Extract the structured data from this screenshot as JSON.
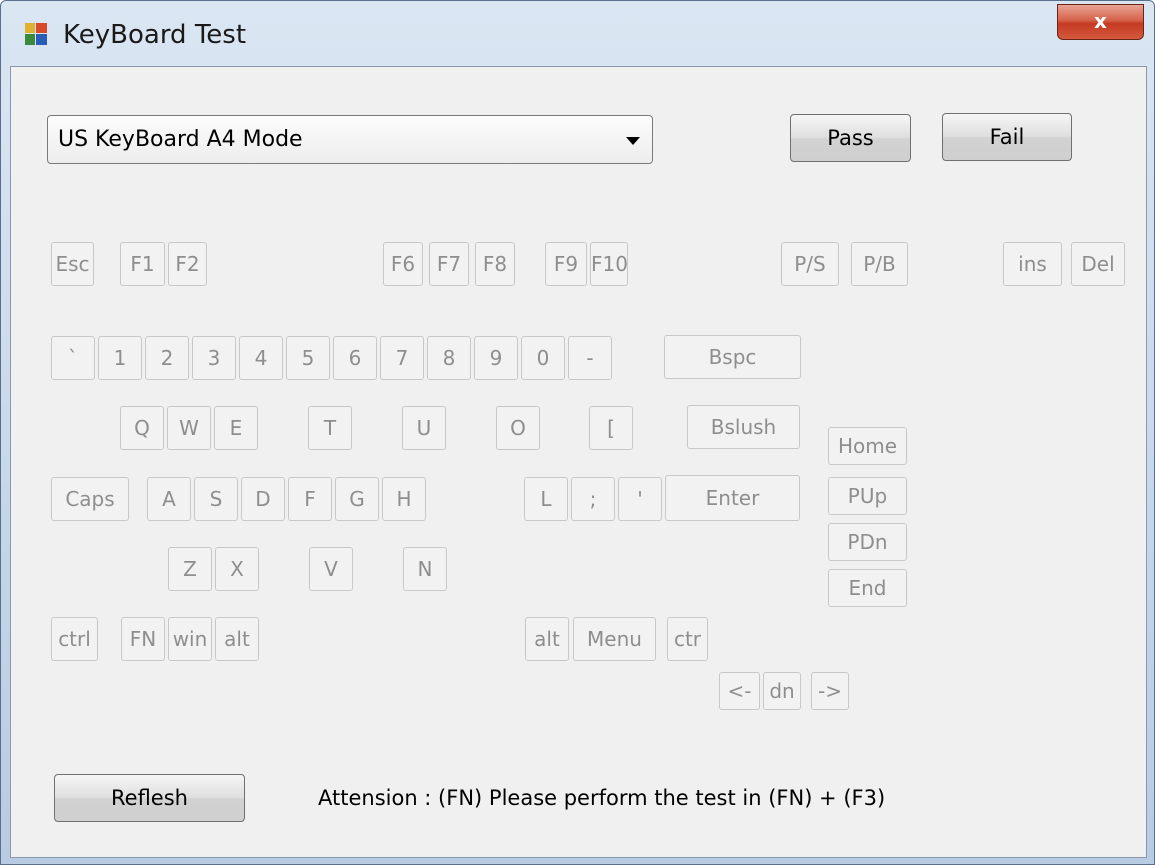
{
  "window": {
    "title": "KeyBoard Test",
    "close_label": "x"
  },
  "mode_select": {
    "value": "US KeyBoard A4 Mode"
  },
  "buttons": {
    "pass": "Pass",
    "fail": "Fail",
    "refresh": "Reflesh"
  },
  "attention": "Attension : (FN) Please perform the test in (FN) + (F3)",
  "keys": {
    "esc": "Esc",
    "f1": "F1",
    "f2": "F2",
    "f6": "F6",
    "f7": "F7",
    "f8": "F8",
    "f9": "F9",
    "f10": "F10",
    "ps": "P/S",
    "pb": "P/B",
    "ins": "ins",
    "del": "Del",
    "backtick": "`",
    "k1": "1",
    "k2": "2",
    "k3": "3",
    "k4": "4",
    "k5": "5",
    "k6": "6",
    "k7": "7",
    "k8": "8",
    "k9": "9",
    "k0": "0",
    "minus": "-",
    "bspc": "Bspc",
    "q": "Q",
    "w": "W",
    "e": "E",
    "t": "T",
    "u": "U",
    "o": "O",
    "lbracket": "[",
    "bslush": "Bslush",
    "home": "Home",
    "pup": "PUp",
    "pdn": "PDn",
    "end": "End",
    "caps": "Caps",
    "a": "A",
    "s": "S",
    "d": "D",
    "f": "F",
    "g": "G",
    "h": "H",
    "l": "L",
    "semicolon": ";",
    "quote": "'",
    "enter": "Enter",
    "z": "Z",
    "x": "X",
    "v": "V",
    "n": "N",
    "ctrl_left": "ctrl",
    "fn": "FN",
    "win": "win",
    "alt_left": "alt",
    "alt_right": "alt",
    "menu": "Menu",
    "ctrl_right": "ctr",
    "left": "<-",
    "down": "dn",
    "right": "->"
  }
}
